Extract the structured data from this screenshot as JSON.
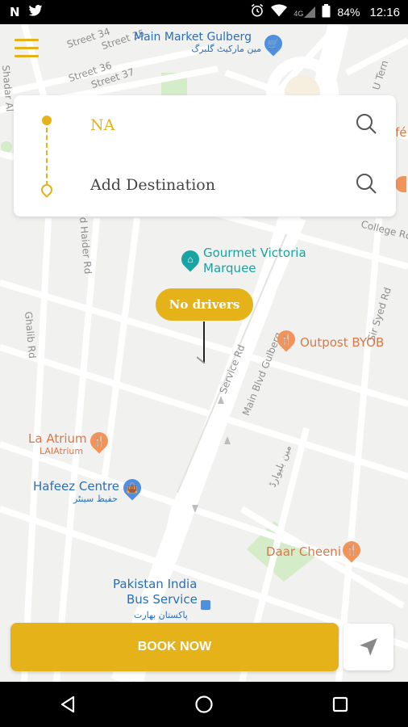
{
  "status_bar": {
    "left_icons": [
      "n-notification-icon",
      "twitter-icon"
    ],
    "right_icons": [
      "alarm-icon",
      "wifi-icon",
      "signal-4g-icon",
      "battery-icon"
    ],
    "network": "4G",
    "battery": "84%",
    "time": "12:16"
  },
  "map": {
    "streets": [
      "Street 34",
      "Street 35",
      "Street 36",
      "Street 37",
      "Shadar Al",
      "d Haider Rd",
      "Ghalib Rd",
      "College Rd",
      "Sir Syed Rd",
      "Service Rd",
      "Main Blvd Gulberg",
      "U Tern"
    ],
    "pois": {
      "main_market": {
        "name": "Main Market Gulberg",
        "urdu": "مین مارکیٹ گلبرگ"
      },
      "gourmet": {
        "line1": "Gourmet Victoria",
        "line2": "Marquee"
      },
      "outpost": {
        "name": "Outpost BYOB"
      },
      "la_atrium": {
        "name": "La Atrium",
        "sub": "LAIAtrium"
      },
      "hafeez": {
        "name": "Hafeez Centre",
        "urdu": "حفیظ سینٹر"
      },
      "daar_cheeni": {
        "name": "Daar Cheeni"
      },
      "pak_india": {
        "line1": "Pakistan India",
        "line2": "Bus Service",
        "urdu": "پاکستان بھارت"
      },
      "cafe_partial": "fé"
    },
    "urdu_road": "مین بلیوارڈ"
  },
  "trip_card": {
    "origin": "NA",
    "destination": "Add Destination"
  },
  "no_drivers_label": "No drivers",
  "book_button": "BOOK NOW",
  "colors": {
    "accent": "#e6b21a",
    "map_bg": "#f1f1ef",
    "poi_blue": "#2a6fb8",
    "poi_orange": "#d9784a"
  }
}
